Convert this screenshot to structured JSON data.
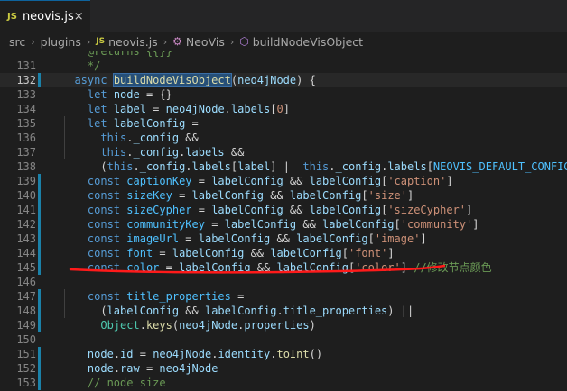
{
  "tab": {
    "badge": "JS",
    "label": "neovis.js",
    "close": "×"
  },
  "breadcrumb": {
    "src": "src",
    "plugins": "plugins",
    "file_badge": "JS",
    "file": "neovis.js",
    "class": "NeoVis",
    "method": "buildNodeVisObject"
  },
  "lines": [
    {
      "n": "",
      "cls": "",
      "tokens": [
        [
          "    ",
          "p"
        ],
        [
          "@returns {{}}",
          "c"
        ]
      ]
    },
    {
      "n": "131",
      "cls": "",
      "tokens": [
        [
          "    */",
          "c"
        ]
      ]
    },
    {
      "n": "132",
      "cls": "current",
      "tokens": [
        [
          "  ",
          "p"
        ],
        [
          "async",
          "k"
        ],
        [
          " ",
          "p"
        ],
        [
          "buildNodeVisObject",
          "hl-fn"
        ],
        [
          "(",
          "p"
        ],
        [
          "neo4jNode",
          "v"
        ],
        [
          ") {",
          "p"
        ]
      ]
    },
    {
      "n": "133",
      "cls": "",
      "tokens": [
        [
          "    ",
          "p"
        ],
        [
          "let",
          "k"
        ],
        [
          " ",
          "p"
        ],
        [
          "node",
          "v"
        ],
        [
          " = {}",
          "p"
        ]
      ]
    },
    {
      "n": "134",
      "cls": "",
      "tokens": [
        [
          "    ",
          "p"
        ],
        [
          "let",
          "k"
        ],
        [
          " ",
          "p"
        ],
        [
          "label",
          "v"
        ],
        [
          " = ",
          "p"
        ],
        [
          "neo4jNode",
          "v"
        ],
        [
          ".",
          "p"
        ],
        [
          "labels",
          "v"
        ],
        [
          "[",
          "p"
        ],
        [
          "0",
          "s"
        ],
        [
          "]",
          "p"
        ]
      ]
    },
    {
      "n": "135",
      "cls": "",
      "tokens": [
        [
          "    ",
          "p"
        ],
        [
          "let",
          "k"
        ],
        [
          " ",
          "p"
        ],
        [
          "labelConfig",
          "v"
        ],
        [
          " =",
          "p"
        ]
      ]
    },
    {
      "n": "136",
      "cls": "",
      "tokens": [
        [
          "      ",
          "p"
        ],
        [
          "this",
          "k"
        ],
        [
          ".",
          "p"
        ],
        [
          "_config",
          "v"
        ],
        [
          " &&",
          "p"
        ]
      ]
    },
    {
      "n": "137",
      "cls": "",
      "tokens": [
        [
          "      ",
          "p"
        ],
        [
          "this",
          "k"
        ],
        [
          ".",
          "p"
        ],
        [
          "_config",
          "v"
        ],
        [
          ".",
          "p"
        ],
        [
          "labels",
          "v"
        ],
        [
          " &&",
          "p"
        ]
      ]
    },
    {
      "n": "138",
      "cls": "",
      "tokens": [
        [
          "      (",
          "p"
        ],
        [
          "this",
          "k"
        ],
        [
          ".",
          "p"
        ],
        [
          "_config",
          "v"
        ],
        [
          ".",
          "p"
        ],
        [
          "labels",
          "v"
        ],
        [
          "[",
          "p"
        ],
        [
          "label",
          "v"
        ],
        [
          "] || ",
          "p"
        ],
        [
          "this",
          "k"
        ],
        [
          ".",
          "p"
        ],
        [
          "_config",
          "v"
        ],
        [
          ".",
          "p"
        ],
        [
          "labels",
          "v"
        ],
        [
          "[",
          "p"
        ],
        [
          "NEOVIS_DEFAULT_CONFIG",
          "cn"
        ],
        [
          "])",
          "p"
        ]
      ]
    },
    {
      "n": "139",
      "cls": "",
      "tokens": [
        [
          "    ",
          "p"
        ],
        [
          "const",
          "k"
        ],
        [
          " ",
          "p"
        ],
        [
          "captionKey",
          "cn"
        ],
        [
          " = ",
          "p"
        ],
        [
          "labelConfig",
          "v"
        ],
        [
          " && ",
          "p"
        ],
        [
          "labelConfig",
          "v"
        ],
        [
          "[",
          "p"
        ],
        [
          "'caption'",
          "s"
        ],
        [
          "]",
          "p"
        ]
      ]
    },
    {
      "n": "140",
      "cls": "",
      "tokens": [
        [
          "    ",
          "p"
        ],
        [
          "const",
          "k"
        ],
        [
          " ",
          "p"
        ],
        [
          "sizeKey",
          "cn"
        ],
        [
          " = ",
          "p"
        ],
        [
          "labelConfig",
          "v"
        ],
        [
          " && ",
          "p"
        ],
        [
          "labelConfig",
          "v"
        ],
        [
          "[",
          "p"
        ],
        [
          "'size'",
          "s"
        ],
        [
          "]",
          "p"
        ]
      ]
    },
    {
      "n": "141",
      "cls": "",
      "tokens": [
        [
          "    ",
          "p"
        ],
        [
          "const",
          "k"
        ],
        [
          " ",
          "p"
        ],
        [
          "sizeCypher",
          "cn"
        ],
        [
          " = ",
          "p"
        ],
        [
          "labelConfig",
          "v"
        ],
        [
          " && ",
          "p"
        ],
        [
          "labelConfig",
          "v"
        ],
        [
          "[",
          "p"
        ],
        [
          "'sizeCypher'",
          "s"
        ],
        [
          "]",
          "p"
        ]
      ]
    },
    {
      "n": "142",
      "cls": "",
      "tokens": [
        [
          "    ",
          "p"
        ],
        [
          "const",
          "k"
        ],
        [
          " ",
          "p"
        ],
        [
          "communityKey",
          "cn"
        ],
        [
          " = ",
          "p"
        ],
        [
          "labelConfig",
          "v"
        ],
        [
          " && ",
          "p"
        ],
        [
          "labelConfig",
          "v"
        ],
        [
          "[",
          "p"
        ],
        [
          "'community'",
          "s"
        ],
        [
          "]",
          "p"
        ]
      ]
    },
    {
      "n": "143",
      "cls": "",
      "tokens": [
        [
          "    ",
          "p"
        ],
        [
          "const",
          "k"
        ],
        [
          " ",
          "p"
        ],
        [
          "imageUrl",
          "cn"
        ],
        [
          " = ",
          "p"
        ],
        [
          "labelConfig",
          "v"
        ],
        [
          " && ",
          "p"
        ],
        [
          "labelConfig",
          "v"
        ],
        [
          "[",
          "p"
        ],
        [
          "'image'",
          "s"
        ],
        [
          "]",
          "p"
        ]
      ]
    },
    {
      "n": "144",
      "cls": "",
      "tokens": [
        [
          "    ",
          "p"
        ],
        [
          "const",
          "k"
        ],
        [
          " ",
          "p"
        ],
        [
          "font",
          "cn"
        ],
        [
          " = ",
          "p"
        ],
        [
          "labelConfig",
          "v"
        ],
        [
          " && ",
          "p"
        ],
        [
          "labelConfig",
          "v"
        ],
        [
          "[",
          "p"
        ],
        [
          "'font'",
          "s"
        ],
        [
          "]",
          "p"
        ]
      ]
    },
    {
      "n": "145",
      "cls": "",
      "tokens": [
        [
          "    ",
          "p"
        ],
        [
          "const",
          "k"
        ],
        [
          " ",
          "p"
        ],
        [
          "color",
          "cn"
        ],
        [
          " = ",
          "p"
        ],
        [
          "labelConfig",
          "v"
        ],
        [
          " && ",
          "p"
        ],
        [
          "labelConfig",
          "v"
        ],
        [
          "[",
          "p"
        ],
        [
          "'color'",
          "s"
        ],
        [
          "] ",
          "p"
        ],
        [
          "//修改节点颜色",
          "c"
        ]
      ]
    },
    {
      "n": "146",
      "cls": "",
      "tokens": []
    },
    {
      "n": "147",
      "cls": "",
      "tokens": [
        [
          "    ",
          "p"
        ],
        [
          "const",
          "k"
        ],
        [
          " ",
          "p"
        ],
        [
          "title_properties",
          "cn"
        ],
        [
          " =",
          "p"
        ]
      ]
    },
    {
      "n": "148",
      "cls": "",
      "tokens": [
        [
          "      (",
          "p"
        ],
        [
          "labelConfig",
          "v"
        ],
        [
          " && ",
          "p"
        ],
        [
          "labelConfig",
          "v"
        ],
        [
          ".",
          "p"
        ],
        [
          "title_properties",
          "v"
        ],
        [
          ") ||",
          "p"
        ]
      ]
    },
    {
      "n": "149",
      "cls": "",
      "tokens": [
        [
          "      ",
          "p"
        ],
        [
          "Object",
          "t"
        ],
        [
          ".",
          "p"
        ],
        [
          "keys",
          "f"
        ],
        [
          "(",
          "p"
        ],
        [
          "neo4jNode",
          "v"
        ],
        [
          ".",
          "p"
        ],
        [
          "properties",
          "v"
        ],
        [
          ")",
          "p"
        ]
      ]
    },
    {
      "n": "150",
      "cls": "",
      "tokens": []
    },
    {
      "n": "151",
      "cls": "",
      "tokens": [
        [
          "    ",
          "p"
        ],
        [
          "node",
          "v"
        ],
        [
          ".",
          "p"
        ],
        [
          "id",
          "v"
        ],
        [
          " = ",
          "p"
        ],
        [
          "neo4jNode",
          "v"
        ],
        [
          ".",
          "p"
        ],
        [
          "identity",
          "v"
        ],
        [
          ".",
          "p"
        ],
        [
          "toInt",
          "f"
        ],
        [
          "()",
          "p"
        ]
      ]
    },
    {
      "n": "152",
      "cls": "",
      "tokens": [
        [
          "    ",
          "p"
        ],
        [
          "node",
          "v"
        ],
        [
          ".",
          "p"
        ],
        [
          "raw",
          "v"
        ],
        [
          " = ",
          "p"
        ],
        [
          "neo4jNode",
          "v"
        ],
        [
          "",
          "p"
        ]
      ]
    },
    {
      "n": "153",
      "cls": "",
      "tokens": [
        [
          "    ",
          "p"
        ],
        [
          "// node size",
          "c"
        ]
      ]
    },
    {
      "n": "154",
      "cls": "",
      "tokens": []
    }
  ]
}
